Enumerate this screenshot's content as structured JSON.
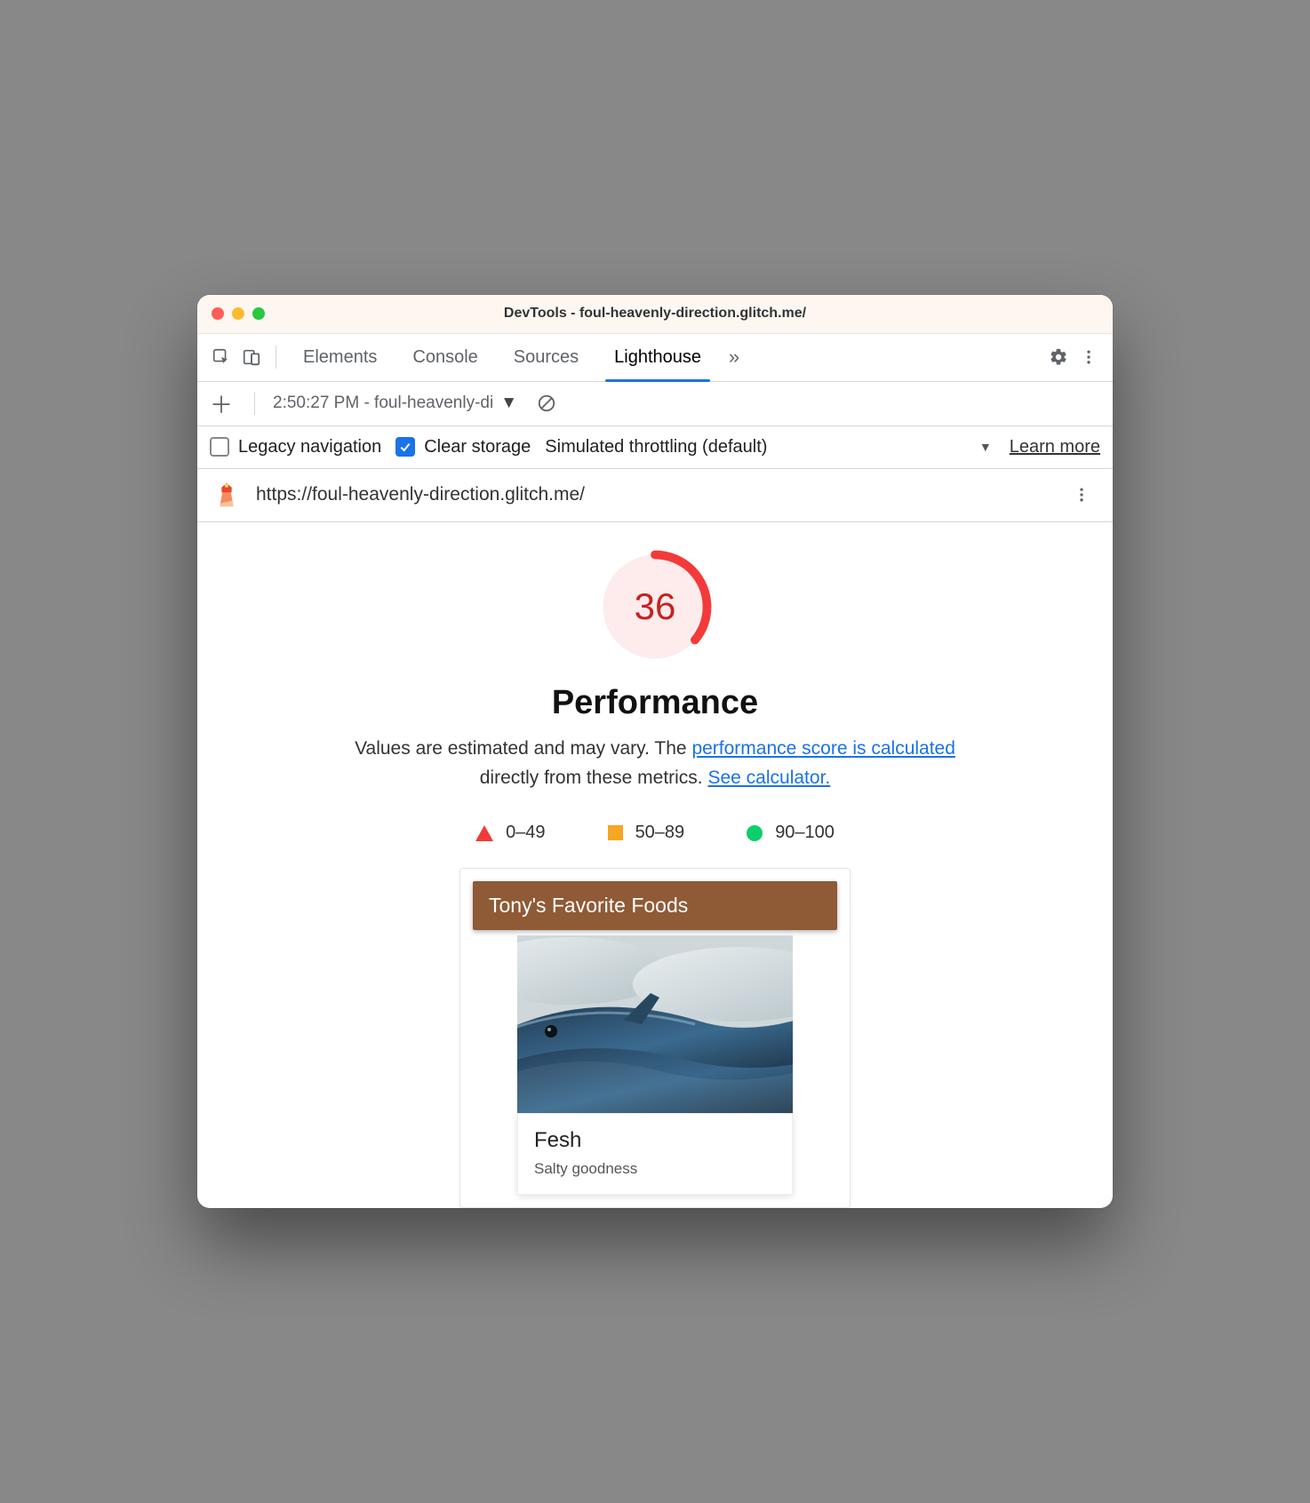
{
  "titlebar": {
    "title": "DevTools - foul-heavenly-direction.glitch.me/"
  },
  "tabs": {
    "items": [
      "Elements",
      "Console",
      "Sources",
      "Lighthouse"
    ],
    "active_index": 3
  },
  "subbar": {
    "report_label": "2:50:27 PM - foul-heavenly-di"
  },
  "options": {
    "legacy_nav_label": "Legacy navigation",
    "legacy_nav_checked": false,
    "clear_storage_label": "Clear storage",
    "clear_storage_checked": true,
    "throttling_label": "Simulated throttling (default)",
    "learn_more": "Learn more"
  },
  "report": {
    "url": "https://foul-heavenly-direction.glitch.me/",
    "score": "36",
    "category": "Performance",
    "desc_prefix": "Values are estimated and may vary. The ",
    "desc_link1": "performance score is calculated",
    "desc_mid": " directly from these metrics. ",
    "desc_link2": "See calculator.",
    "legend": {
      "fail": "0–49",
      "avg": "50–89",
      "pass": "90–100"
    },
    "screenshot": {
      "header": "Tony's Favorite Foods",
      "card_title": "Fesh",
      "card_sub": "Salty goodness"
    }
  }
}
